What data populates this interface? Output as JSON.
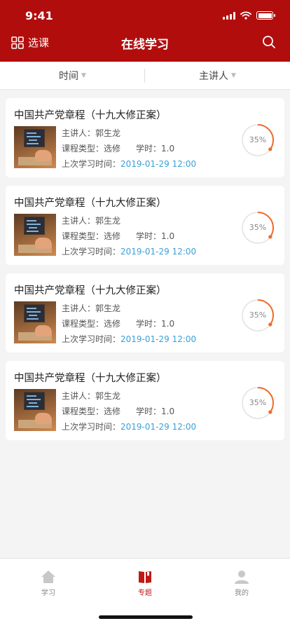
{
  "status": {
    "time": "9:41"
  },
  "header": {
    "course_select_label": "选课",
    "title": "在线学习"
  },
  "filters": [
    {
      "label": "时间"
    },
    {
      "label": "主讲人"
    }
  ],
  "courses": [
    {
      "title": "中国共产党章程（十九大修正案）",
      "lecturer_label": "主讲人：",
      "lecturer": "郭生龙",
      "type_label": "课程类型：",
      "type": "选修",
      "hours_label": "学时：",
      "hours": "1.0",
      "last_label": "上次学习时间：",
      "last_time": "2019-01-29 12:00",
      "progress_text": "35%",
      "progress": 0.35
    },
    {
      "title": "中国共产党章程（十九大修正案）",
      "lecturer_label": "主讲人：",
      "lecturer": "郭生龙",
      "type_label": "课程类型：",
      "type": "选修",
      "hours_label": "学时：",
      "hours": "1.0",
      "last_label": "上次学习时间：",
      "last_time": "2019-01-29 12:00",
      "progress_text": "35%",
      "progress": 0.35
    },
    {
      "title": "中国共产党章程（十九大修正案）",
      "lecturer_label": "主讲人：",
      "lecturer": "郭生龙",
      "type_label": "课程类型：",
      "type": "选修",
      "hours_label": "学时：",
      "hours": "1.0",
      "last_label": "上次学习时间：",
      "last_time": "2019-01-29 12:00",
      "progress_text": "35%",
      "progress": 0.35
    },
    {
      "title": "中国共产党章程（十九大修正案）",
      "lecturer_label": "主讲人：",
      "lecturer": "郭生龙",
      "type_label": "课程类型：",
      "type": "选修",
      "hours_label": "学时：",
      "hours": "1.0",
      "last_label": "上次学习时间：",
      "last_time": "2019-01-29 12:00",
      "progress_text": "35%",
      "progress": 0.35
    }
  ],
  "tabbar": [
    {
      "label": "学习",
      "icon": "home-icon",
      "active": false
    },
    {
      "label": "专题",
      "icon": "book-icon",
      "active": true
    },
    {
      "label": "我的",
      "icon": "user-icon",
      "active": false
    }
  ],
  "colors": {
    "brand": "#b20d0d",
    "progress": "#f06a2a",
    "date": "#3aa0d8",
    "tab_active": "#c01818"
  }
}
